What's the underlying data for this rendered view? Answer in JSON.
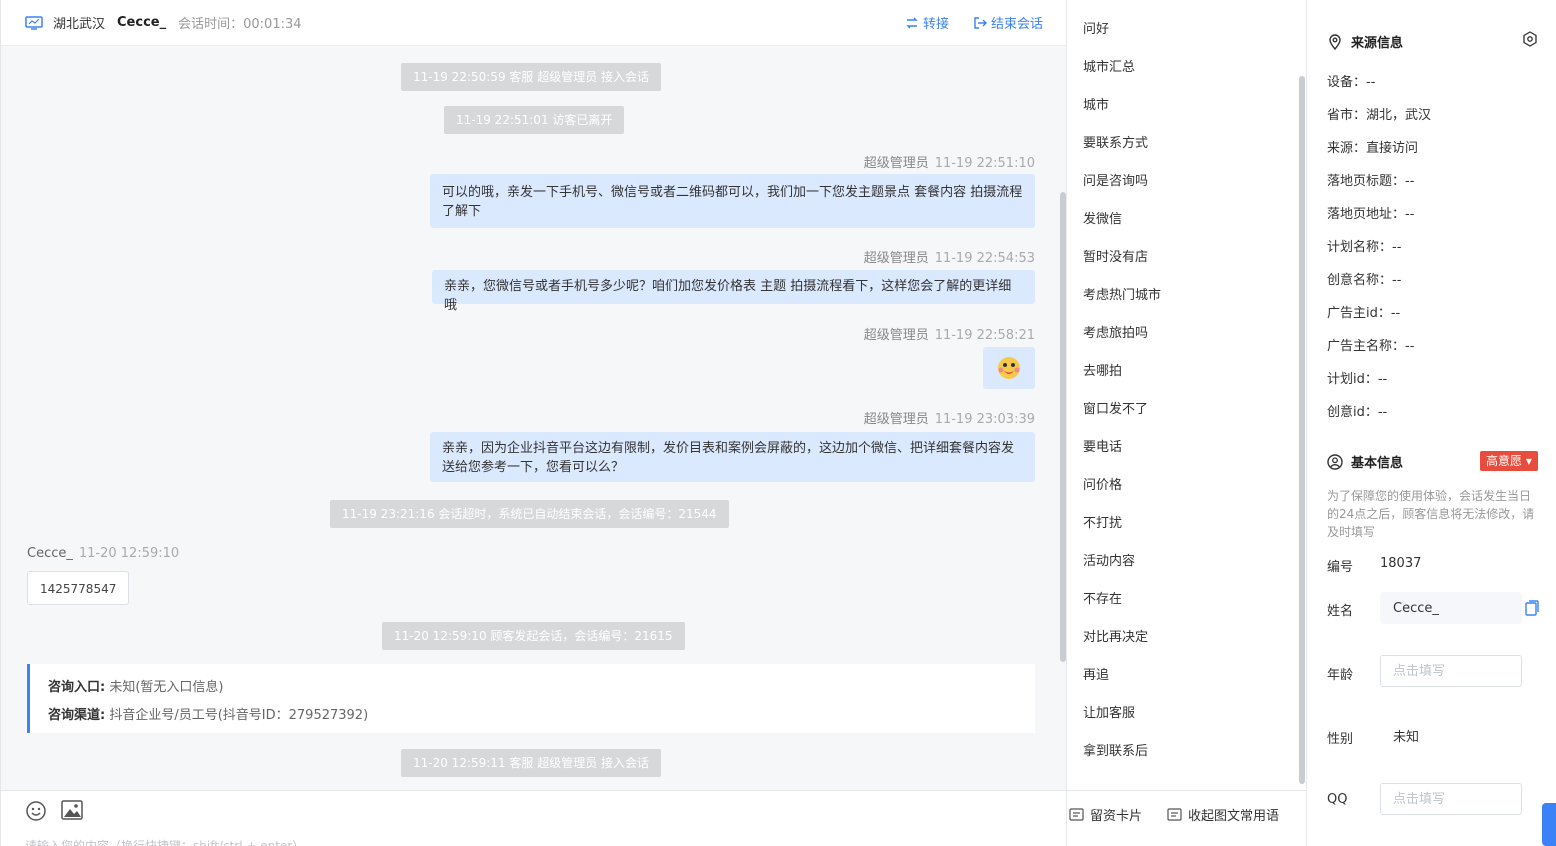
{
  "header": {
    "region": "湖北武汉",
    "visitor": "Cecce_",
    "duration_label": "会话时间：",
    "duration_value": "00:01:34",
    "transfer_label": "转接",
    "end_label": "结束会话"
  },
  "messages": {
    "sys1": "11-19 22:50:59 客服 超级管理员 接入会话",
    "sys2": "11-19 22:51:01 访客已离开",
    "m1": {
      "sender": "超级管理员",
      "time": "11-19 22:51:10",
      "text": "可以的哦，亲发一下手机号、微信号或者二维码都可以，我们加一下您发主题景点 套餐内容 拍摄流程了解下"
    },
    "m2": {
      "sender": "超级管理员",
      "time": "11-19 22:54:53",
      "text": "亲亲，您微信号或者手机号多少呢？咱们加您发价格表 主题 拍摄流程看下，这样您会了解的更详细哦"
    },
    "m3": {
      "sender": "超级管理员",
      "time": "11-19 22:58:21"
    },
    "m4": {
      "sender": "超级管理员",
      "time": "11-19 23:03:39",
      "text": "亲亲，因为企业抖音平台这边有限制，发价目表和案例会屏蔽的，这边加个微信、把详细套餐内容发送给您参考一下，您看可以么？"
    },
    "sys3": "11-19 23:21:16 会话超时，系统已自动结束会话，会话编号：21544",
    "m5": {
      "sender": "Cecce_",
      "time": "11-20 12:59:10",
      "text": "1425778547"
    },
    "sys4": "11-20 12:59:10 顾客发起会话，会话编号：21615",
    "entry_label": "咨询入口:",
    "entry_value": "未知(暂无入口信息)",
    "channel_label": "咨询渠道:",
    "channel_value": "抖音企业号/员工号(抖音号ID：279527392)",
    "sys5": "11-20 12:59:11 客服 超级管理员 接入会话"
  },
  "input": {
    "placeholder": "请输入您的内容（换行快捷键：shift/ctrl + enter）"
  },
  "phrases": [
    "问好",
    "城市汇总",
    "城市",
    "要联系方式",
    "问是咨询吗",
    "发微信",
    "暂时没有店",
    "考虑热门城市",
    "考虑旅拍吗",
    "去哪拍",
    "窗口发不了",
    "要电话",
    "问价格",
    "不打扰",
    "活动内容",
    "不存在",
    "对比再决定",
    "再追",
    "让加客服",
    "拿到联系后"
  ],
  "phrase_footer": {
    "card_label": "留资卡片",
    "collapse_label": "收起图文常用语"
  },
  "source_info": {
    "title": "来源信息",
    "rows": [
      "设备：--",
      "省市：湖北，武汉",
      "来源：直接访问",
      "落地页标题：--",
      "落地页地址：--",
      "计划名称：--",
      "创意名称：--",
      "广告主id：--",
      "广告主名称：--",
      "计划id：--",
      "创意id：--"
    ]
  },
  "basic_info": {
    "title": "基本信息",
    "badge": "高意愿",
    "tip": "为了保障您的使用体验，会话发生当日的24点之后，顾客信息将无法修改，请及时填写",
    "id_label": "编号",
    "id_value": "18037",
    "name_label": "姓名",
    "name_value": "Cecce_",
    "age_label": "年龄",
    "age_placeholder": "点击填写",
    "gender_label": "性别",
    "gender_value": "未知",
    "qq_label": "QQ",
    "qq_placeholder": "点击填写"
  },
  "colors": {
    "accent": "#3b82f6",
    "bubble": "#dbe9ff",
    "system": "#d7d8da",
    "badge": "#e74c3c"
  }
}
